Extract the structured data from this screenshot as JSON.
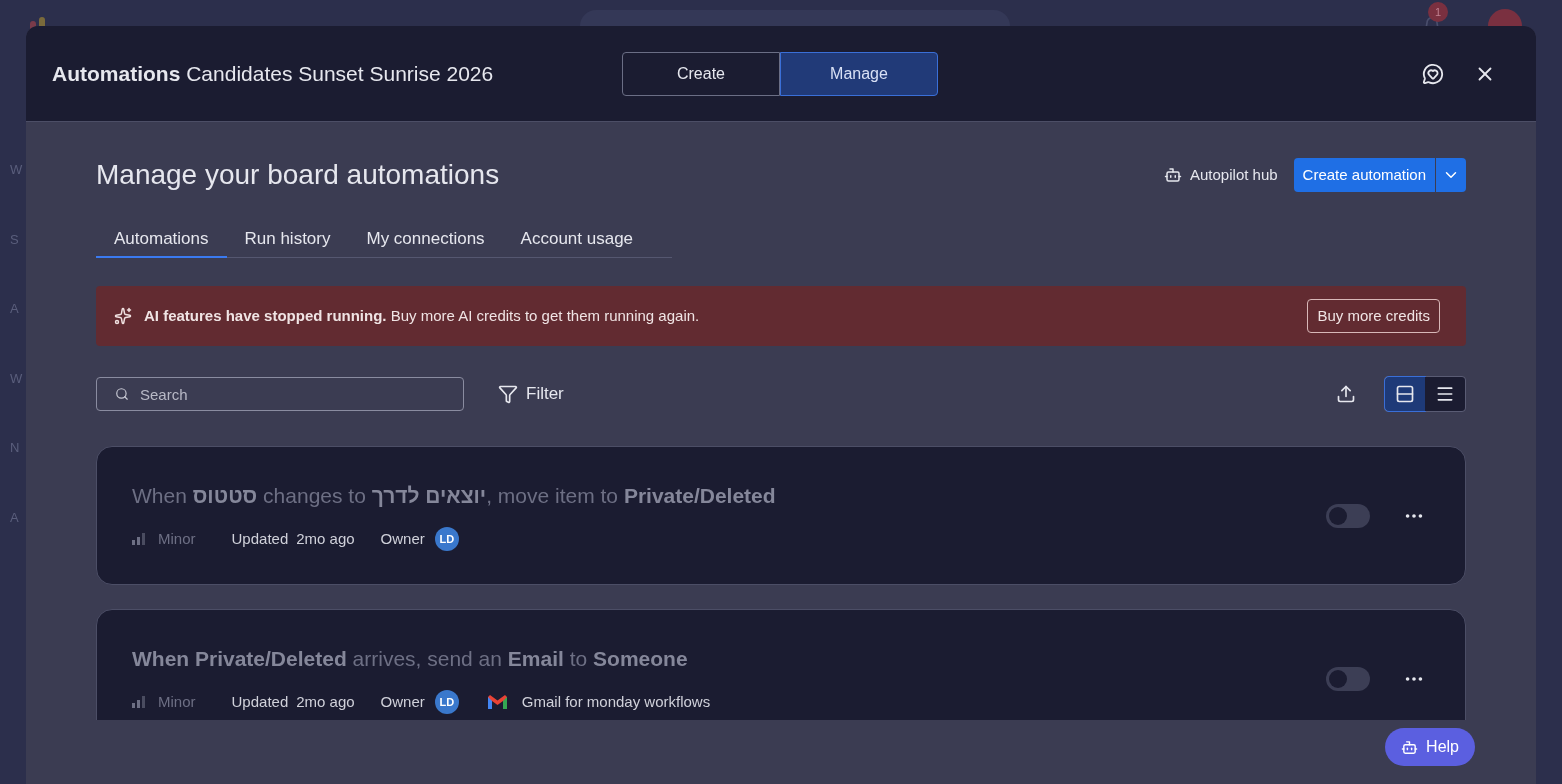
{
  "app_shell": {
    "notification_count": "1",
    "sidebar_items": [
      "W",
      "S",
      "A",
      "W",
      "N",
      "A"
    ]
  },
  "modal": {
    "title_bold": "Automations",
    "title": "Candidates Sunset Sunrise 2026",
    "mode_tabs": [
      {
        "label": "Create",
        "selected": false
      },
      {
        "label": "Manage",
        "selected": true
      }
    ]
  },
  "heading": "Manage your board automations",
  "autopilot": "Autopilot hub",
  "create_button": "Create automation",
  "tabs": [
    {
      "label": "Automations",
      "selected": true
    },
    {
      "label": "Run history",
      "selected": false
    },
    {
      "label": "My connections",
      "selected": false
    },
    {
      "label": "Account usage",
      "selected": false
    }
  ],
  "banner": {
    "bold": "AI features have stopped running.",
    "text": "Buy more AI credits to get them running again.",
    "button": "Buy more credits"
  },
  "search": {
    "placeholder": "Search"
  },
  "filter": "Filter",
  "view_modes": [
    {
      "kind": "cards",
      "selected": true
    },
    {
      "kind": "list",
      "selected": false
    }
  ],
  "automations": [
    {
      "title": "When **סטטוס** changes to **יוצאים לדרך**, move item to **Private/Deleted**",
      "priority": "Minor",
      "updated_label": "Updated",
      "updated": "2mo ago",
      "owner_label": "Owner",
      "owner": "LD",
      "on": false
    },
    {
      "title": "**When Private/Deleted** arrives, send an **Email** to **Someone**",
      "priority": "Minor",
      "updated_label": "Updated",
      "updated": "2mo ago",
      "owner_label": "Owner",
      "owner": "LD",
      "integration": "Gmail for monday workflows",
      "on": false
    }
  ],
  "help": "Help"
}
